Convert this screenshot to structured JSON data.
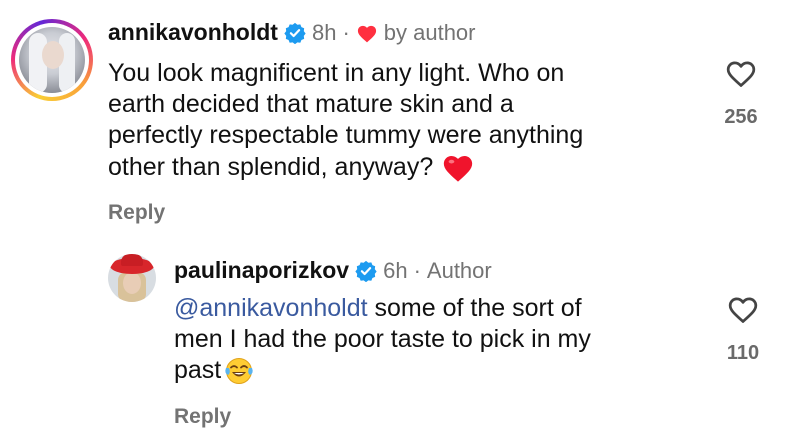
{
  "comments": [
    {
      "username": "annikavonholdt",
      "time": "8h",
      "separator": "·",
      "badge_text": "by author",
      "text_lines": [
        "You look magnificent in any light. Who on",
        "earth decided that mature skin and a",
        "perfectly respectable tummy were anything",
        "other than splendid, anyway?"
      ],
      "reply_label": "Reply",
      "like_count": "256"
    },
    {
      "username": "paulinaporizkov",
      "time": "6h",
      "separator": "·",
      "badge_text": "Author",
      "mention": "@annikavonholdt",
      "text_lines": [
        " some of the sort of",
        "men I had the poor taste to pick in my",
        "past"
      ],
      "reply_label": "Reply",
      "like_count": "110"
    }
  ],
  "colors": {
    "verified": "#1d9bf0",
    "heart_red": "#ff3040",
    "mention": "#3a5a9f",
    "muted": "#737373"
  },
  "icons": {
    "verified": "verified-badge-icon",
    "author_heart": "heart-filled-icon",
    "like": "heart-outline-icon",
    "emoji_heart": "red-heart-emoji",
    "emoji_laugh": "tears-of-joy-emoji"
  }
}
